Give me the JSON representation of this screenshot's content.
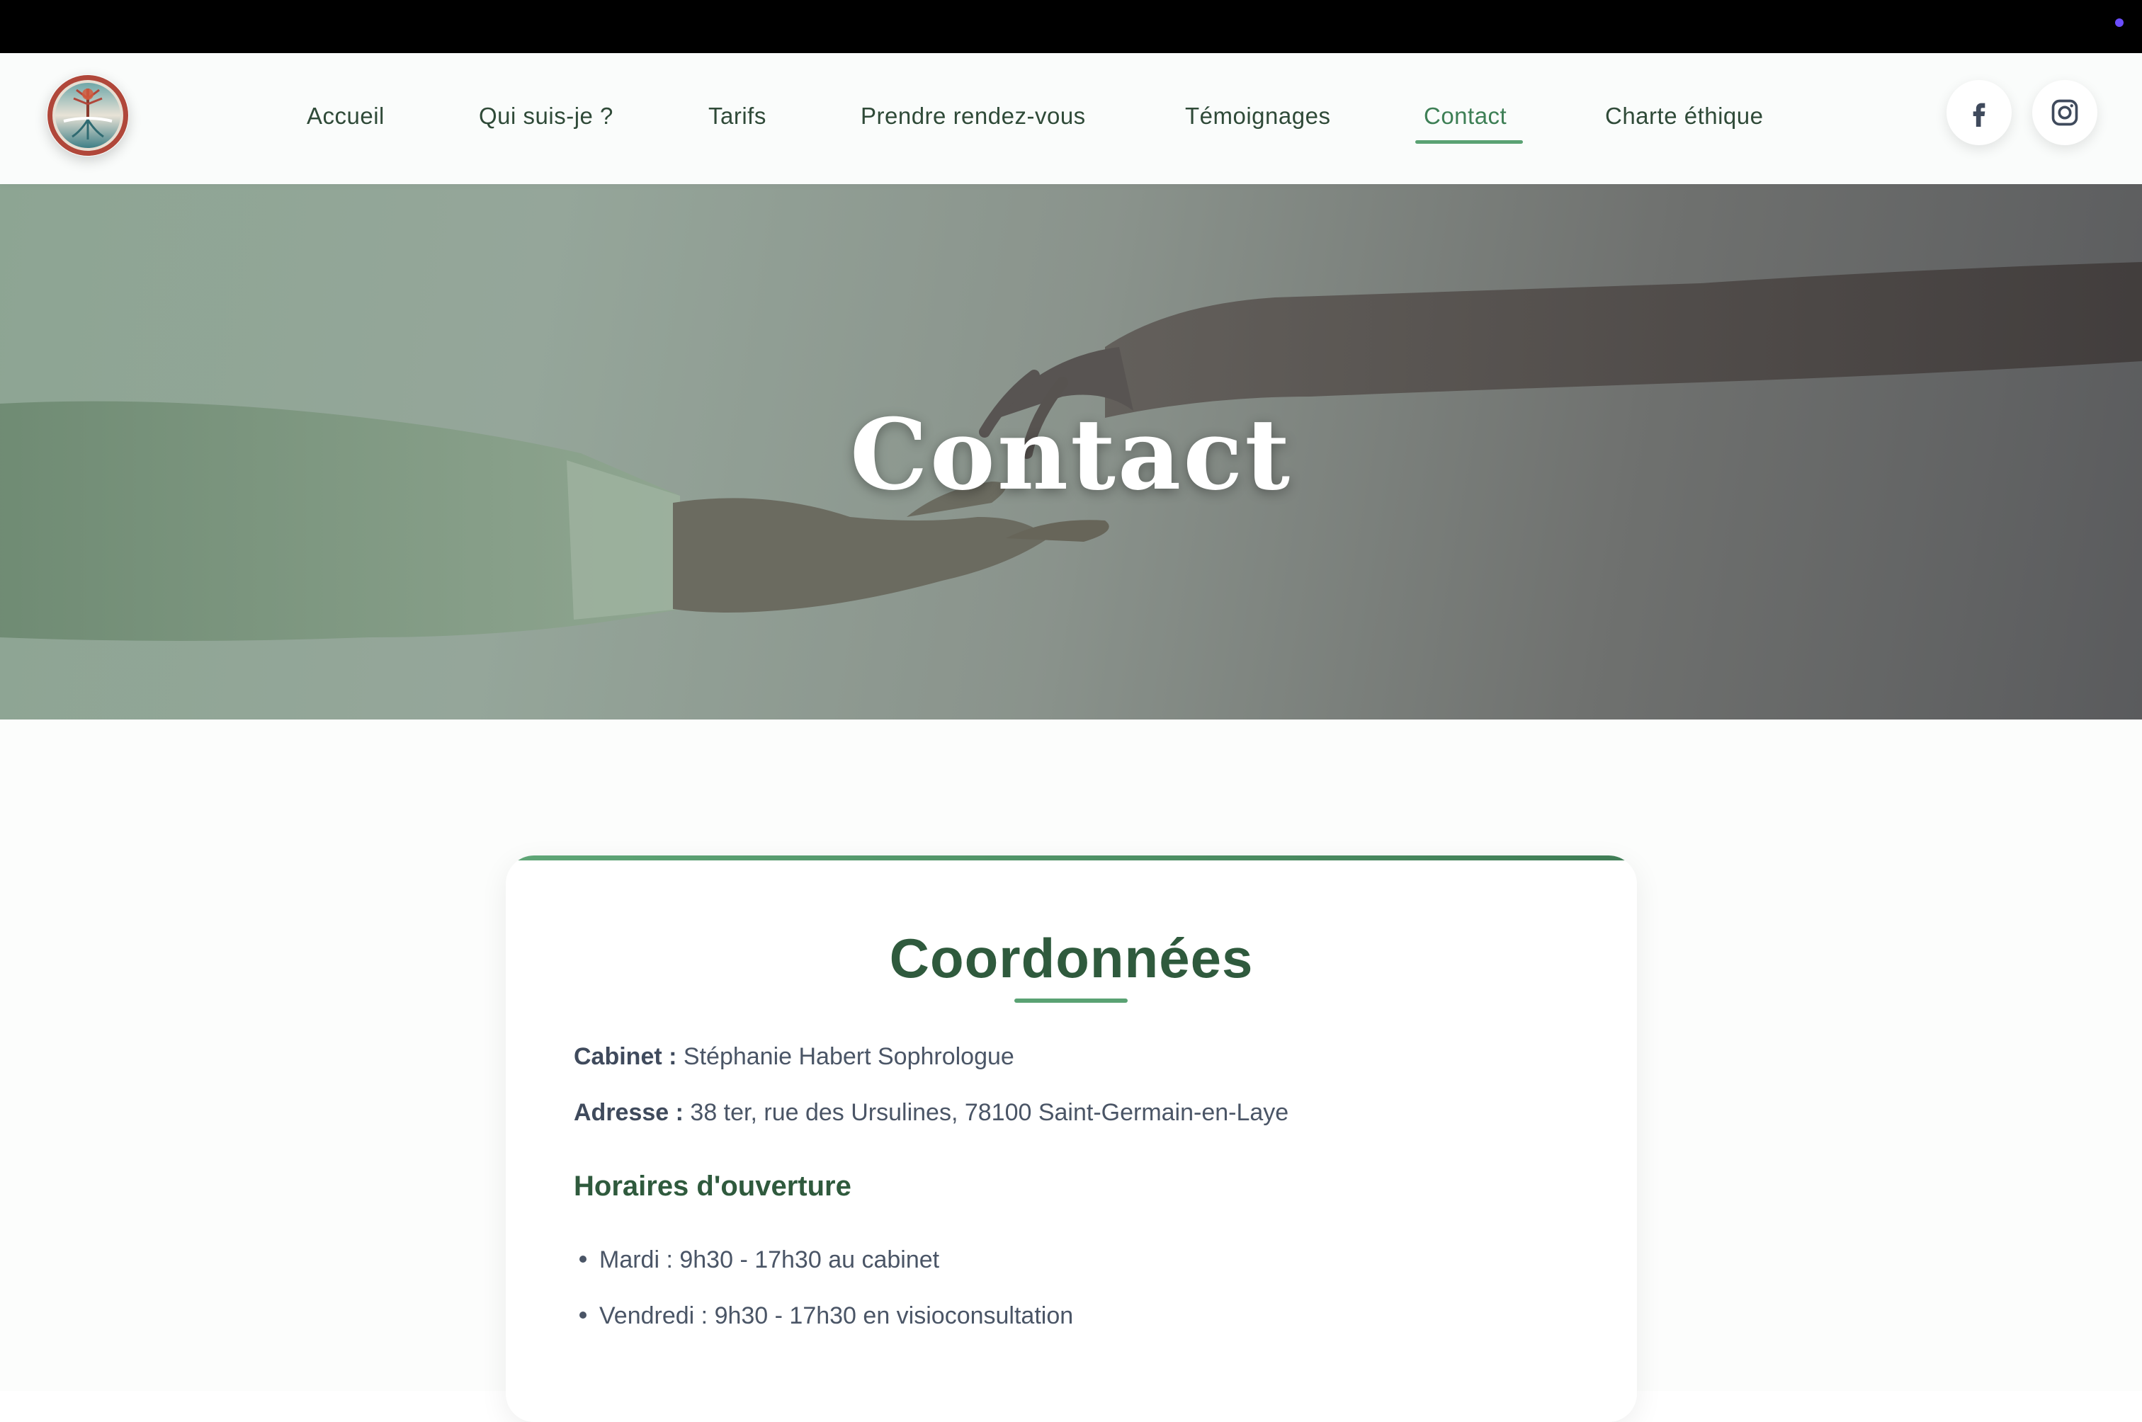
{
  "nav": {
    "items": [
      {
        "label": "Accueil",
        "active": false
      },
      {
        "label": "Qui suis-je ?",
        "active": false
      },
      {
        "label": "Tarifs",
        "active": false
      },
      {
        "label": "Prendre rendez-vous",
        "active": false
      },
      {
        "label": "Témoignages",
        "active": false
      },
      {
        "label": "Contact",
        "active": true
      },
      {
        "label": "Charte éthique",
        "active": false
      }
    ]
  },
  "social": {
    "facebook_icon": "facebook-icon",
    "instagram_icon": "instagram-icon"
  },
  "hero": {
    "title": "Contact"
  },
  "card": {
    "title": "Coordonnées",
    "cabinet_label": "Cabinet :",
    "cabinet_value": "Stéphanie Habert Sophrologue",
    "address_label": "Adresse :",
    "address_value": "38 ter, rue des Ursulines, 78100 Saint-Germain-en-Laye",
    "hours_title": "Horaires d'ouverture",
    "hours": [
      "Mardi : 9h30 - 17h30 au cabinet",
      "Vendredi : 9h30 - 17h30 en visioconsultation"
    ]
  },
  "colors": {
    "accent": "#5aa273",
    "title_green": "#2f5a3d",
    "text": "#4a5566"
  }
}
